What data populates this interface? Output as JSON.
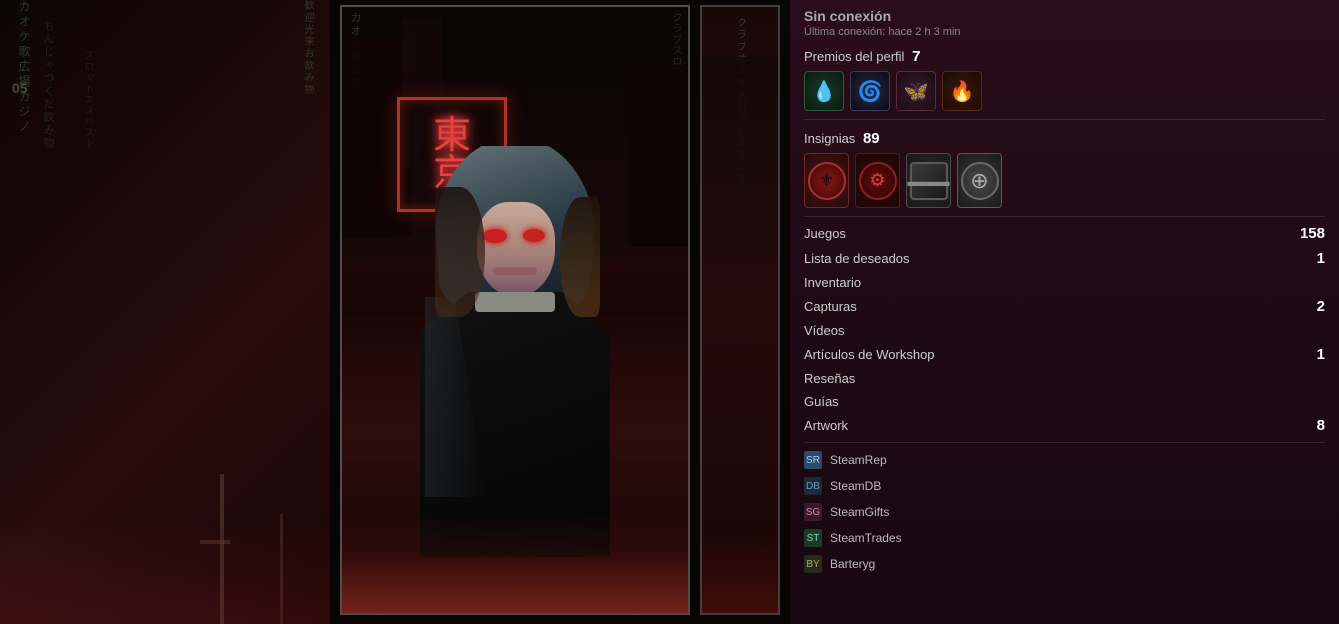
{
  "leftBg": {
    "kanjiLines": [
      "カオケ",
      "歌広場",
      "カジノ",
      "もんじゃ",
      "つくだ",
      "飲み物",
      "歓迎"
    ]
  },
  "neonSign": {
    "text": "東\n京"
  },
  "rightFrame": {
    "kanjiLines": [
      "クラブ",
      "オーケ",
      "スロット",
      "エスハスト"
    ]
  },
  "sidebar": {
    "status": {
      "offline": "Sin conexión",
      "lastSeen": "Última conexión: hace 2 h 3 min"
    },
    "profileRewards": {
      "label": "Premios del perfil",
      "count": "7",
      "badges": [
        {
          "id": "drop",
          "icon": "💧"
        },
        {
          "id": "swirl",
          "icon": "🌀"
        },
        {
          "id": "wings",
          "icon": "🦋"
        },
        {
          "id": "fire",
          "icon": "🔥"
        }
      ]
    },
    "insignias": {
      "label": "Insignias",
      "count": "89",
      "items": [
        {
          "id": "red-seal",
          "icon": "🔴"
        },
        {
          "id": "dark-emblem",
          "icon": "⚙️"
        },
        {
          "id": "gray-bar",
          "icon": "📊"
        },
        {
          "id": "plus-circle",
          "icon": "➕"
        }
      ]
    },
    "stats": [
      {
        "label": "Juegos",
        "count": "158",
        "key": "games"
      },
      {
        "label": "Lista de deseados",
        "count": "1",
        "key": "wishlist"
      },
      {
        "label": "Inventario",
        "count": "",
        "key": "inventory"
      },
      {
        "label": "Capturas",
        "count": "2",
        "key": "screenshots"
      },
      {
        "label": "Vídeos",
        "count": "",
        "key": "videos"
      },
      {
        "label": "Artículos de Workshop",
        "count": "1",
        "key": "workshop"
      },
      {
        "label": "Reseñas",
        "count": "",
        "key": "reviews"
      },
      {
        "label": "Guías",
        "count": "",
        "key": "guides"
      },
      {
        "label": "Artwork",
        "count": "8",
        "key": "artwork"
      }
    ],
    "externalLinks": [
      {
        "label": "SteamRep",
        "icon": "SR",
        "key": "steamrep"
      },
      {
        "label": "SteamDB",
        "icon": "DB",
        "key": "steamdb"
      },
      {
        "label": "SteamGifts",
        "icon": "SG",
        "key": "steamgifts"
      },
      {
        "label": "SteamTrades",
        "icon": "ST",
        "key": "steamtrades"
      },
      {
        "label": "Barteryg",
        "icon": "BY",
        "key": "barteryg"
      }
    ]
  }
}
